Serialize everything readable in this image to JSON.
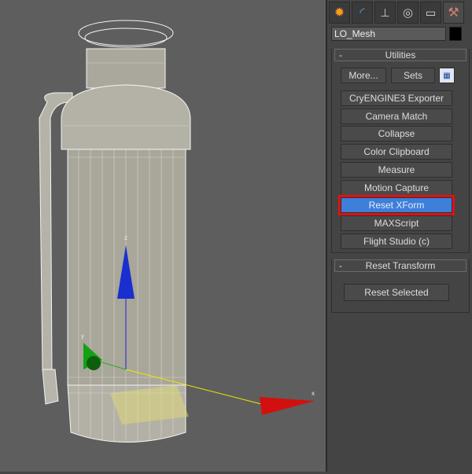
{
  "command_tabs": [
    {
      "icon": "create-icon"
    },
    {
      "icon": "modify-icon"
    },
    {
      "icon": "hierarchy-icon"
    },
    {
      "icon": "motion-icon"
    },
    {
      "icon": "display-icon"
    },
    {
      "icon": "utilities-hammer-icon",
      "active": true
    }
  ],
  "object_name": "LO_Mesh",
  "object_color": "#000000",
  "utilities": {
    "title": "Utilities",
    "collapse": "-",
    "more": "More...",
    "sets": "Sets",
    "config_icon": "configure-button-sets-icon",
    "items": [
      "CryENGINE3 Exporter",
      "Camera Match",
      "Collapse",
      "Color Clipboard",
      "Measure",
      "Motion Capture",
      "Reset XForm",
      "MAXScript",
      "Flight Studio (c)"
    ],
    "selected": "Reset XForm",
    "highlight_color": "#3d7fd9",
    "outline_color": "#e41010"
  },
  "reset_transform": {
    "title": "Reset Transform",
    "collapse": "-",
    "button": "Reset Selected"
  },
  "gizmo": {
    "x_label": "x",
    "y_label": "y",
    "z_label": "z"
  }
}
